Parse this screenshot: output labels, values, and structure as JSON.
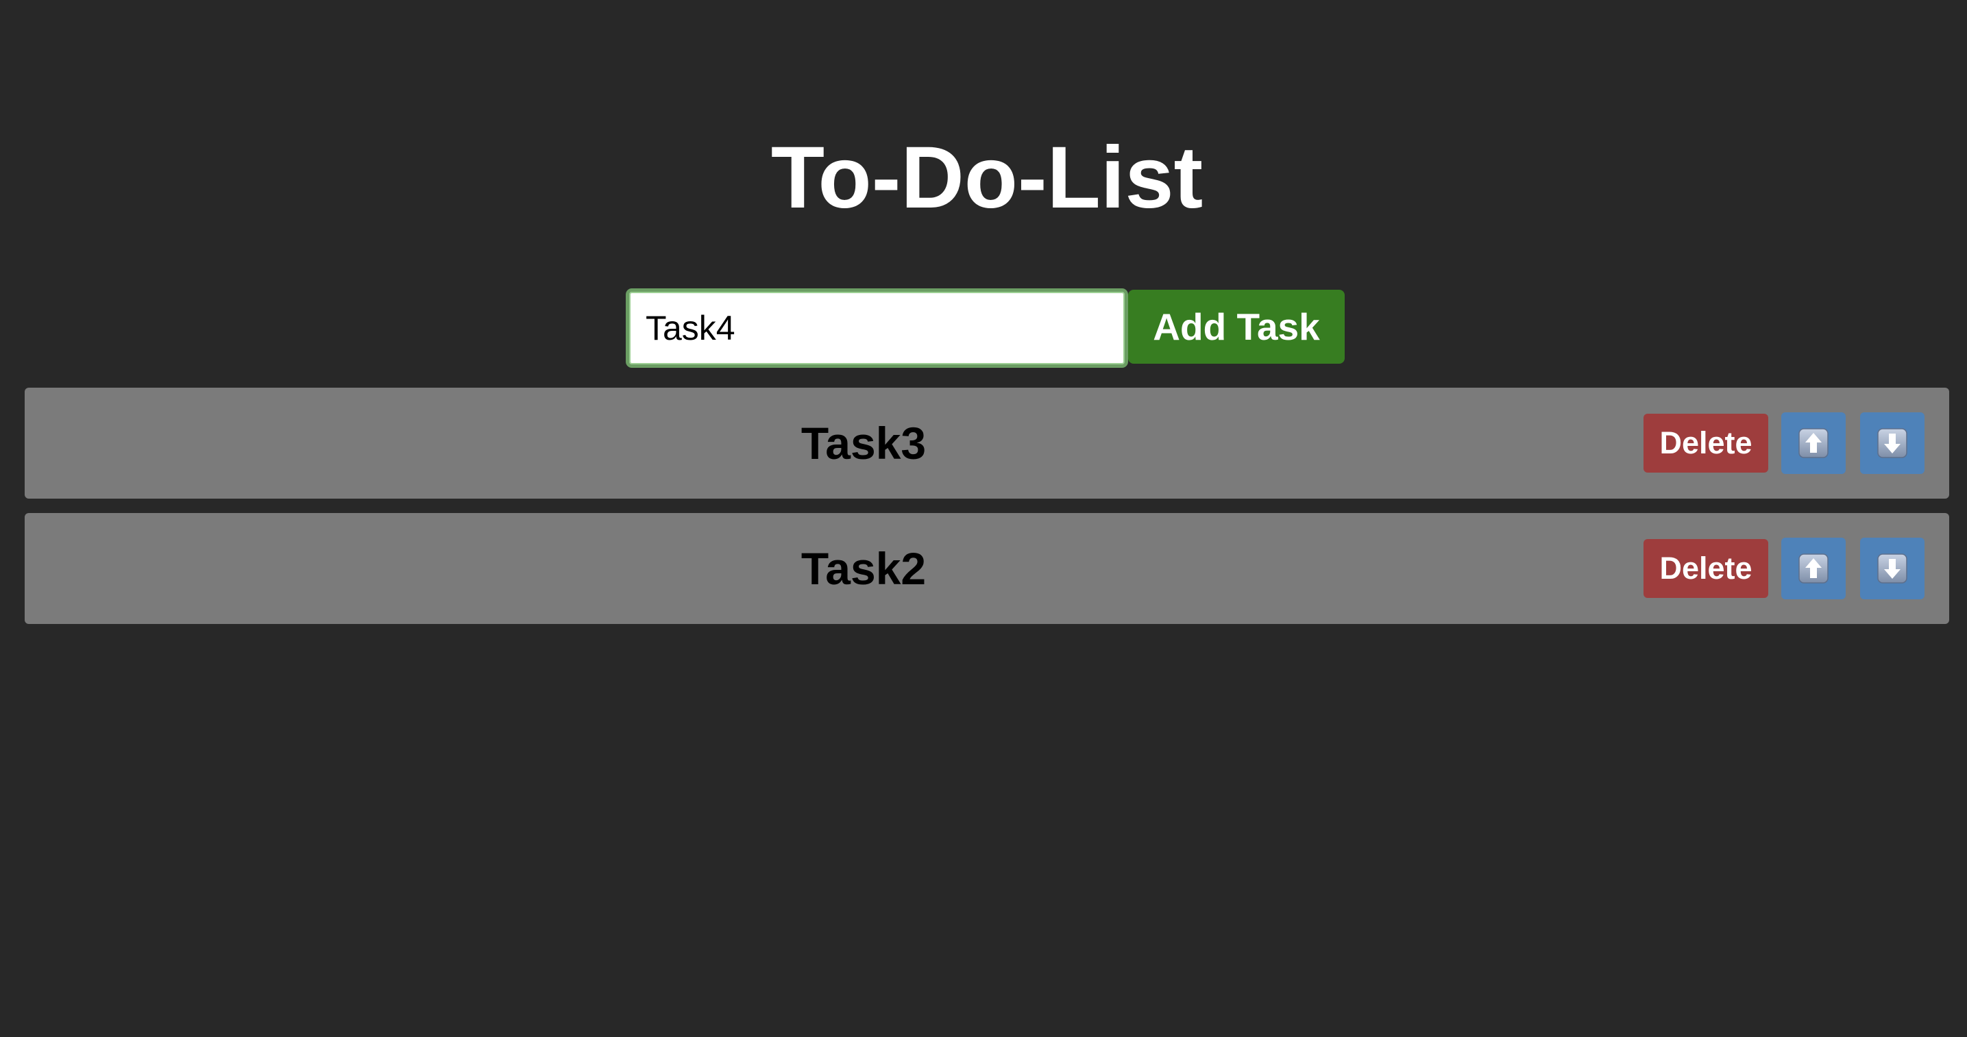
{
  "header": {
    "title": "To-Do-List"
  },
  "new_task": {
    "value": "Task4",
    "button_label": "Add Task"
  },
  "tasks": [
    {
      "label": "Task3",
      "delete_label": "Delete"
    },
    {
      "label": "Task2",
      "delete_label": "Delete"
    }
  ],
  "icons": {
    "move_up": "arrow-up-icon",
    "move_down": "arrow-down-icon"
  },
  "colors": {
    "background": "#282828",
    "add_button": "#377d21",
    "delete_button": "#9e3d3d",
    "move_button": "#4e82b9",
    "task_row": "#7b7b7b",
    "input_border": "#6b9e63"
  }
}
